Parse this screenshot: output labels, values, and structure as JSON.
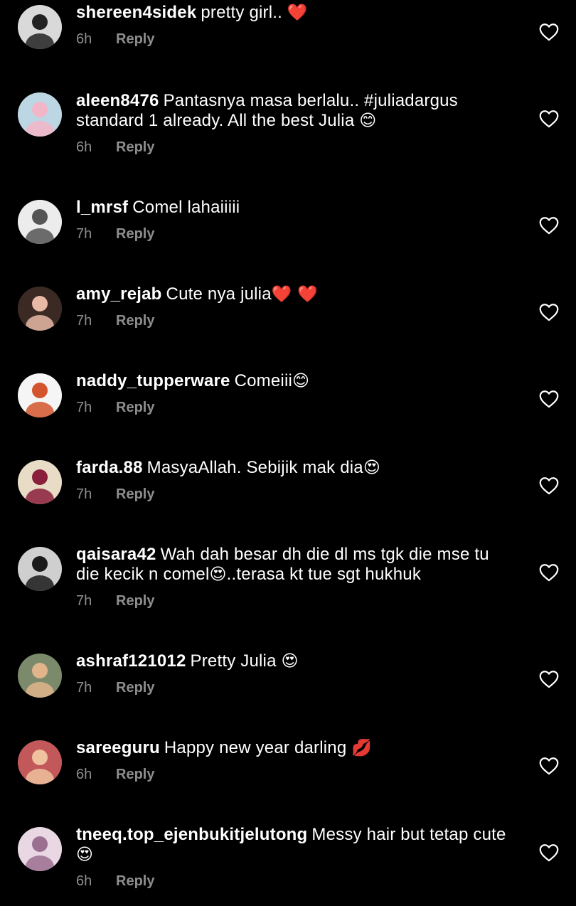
{
  "comments": [
    {
      "username": "shereen4sidek",
      "text": "pretty girl.. ",
      "emoji": "❤️",
      "time": "6h",
      "reply": "Reply",
      "avatar_color": "#d9d9d9",
      "avatar_accent": "#222222"
    },
    {
      "username": "aleen8476",
      "text": "Pantasnya masa berlalu.. #juliadargus standard 1 already. All the best Julia ",
      "emoji": "😊",
      "time": "6h",
      "reply": "Reply",
      "avatar_color": "#bcd7e3",
      "avatar_accent": "#f3b6c8"
    },
    {
      "username": "l_mrsf",
      "text": "Comel lahaiiiii",
      "emoji": "",
      "time": "7h",
      "reply": "Reply",
      "avatar_color": "#ececec",
      "avatar_accent": "#555555"
    },
    {
      "username": "amy_rejab",
      "text": "Cute nya julia",
      "emoji": "❤️ ❤️",
      "time": "7h",
      "reply": "Reply",
      "avatar_color": "#3b2a24",
      "avatar_accent": "#e8b9a6"
    },
    {
      "username": "naddy_tupperware",
      "text": "Comeiii",
      "emoji": "😊",
      "time": "7h",
      "reply": "Reply",
      "avatar_color": "#f5f5f5",
      "avatar_accent": "#d2552d"
    },
    {
      "username": "farda.88",
      "text": "MasyaAllah. Sebijik mak dia",
      "emoji": "😍",
      "time": "7h",
      "reply": "Reply",
      "avatar_color": "#e8dcc7",
      "avatar_accent": "#8a1f3b"
    },
    {
      "username": "qaisara42",
      "text": "Wah dah besar dh die dl ms tgk die mse tu die kecik n comel",
      "emoji": "😍",
      "text2": "..terasa kt tue sgt hukhuk",
      "time": "7h",
      "reply": "Reply",
      "avatar_color": "#cfcfcf",
      "avatar_accent": "#1a1a1a"
    },
    {
      "username": "ashraf121012",
      "text": "Pretty Julia ",
      "emoji": "😍",
      "time": "7h",
      "reply": "Reply",
      "avatar_color": "#7a8a6a",
      "avatar_accent": "#e2b48c"
    },
    {
      "username": "sareeguru",
      "text": "Happy new year darling ",
      "emoji": "💋",
      "time": "6h",
      "reply": "Reply",
      "avatar_color": "#c2585a",
      "avatar_accent": "#f0c19e"
    },
    {
      "username": "tneeq.top_ejenbukitjelutong",
      "text": "Messy hair but tetap cute ",
      "emoji": "😍",
      "time": "6h",
      "reply": "Reply",
      "avatar_color": "#e9d7e4",
      "avatar_accent": "#9b6f8f"
    }
  ]
}
